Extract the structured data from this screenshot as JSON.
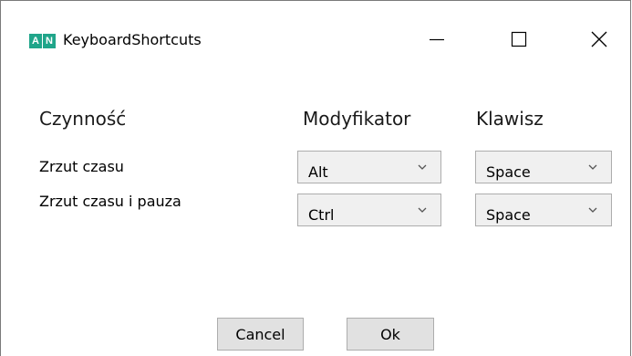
{
  "window": {
    "title": "KeyboardShortcuts",
    "icon_letters": [
      "A",
      "N"
    ],
    "icon_color": "#20a58a"
  },
  "caption_buttons": {
    "minimize": "minimize-icon",
    "maximize": "maximize-icon",
    "close": "close-icon"
  },
  "headers": {
    "action": "Czynność",
    "modifier": "Modyfikator",
    "key": "Klawisz"
  },
  "rows": [
    {
      "label": "Zrzut czasu",
      "modifier": "Alt",
      "key": "Space"
    },
    {
      "label": "Zrzut czasu i pauza",
      "modifier": "Ctrl",
      "key": "Space"
    }
  ],
  "buttons": {
    "cancel": "Cancel",
    "ok": "Ok"
  }
}
